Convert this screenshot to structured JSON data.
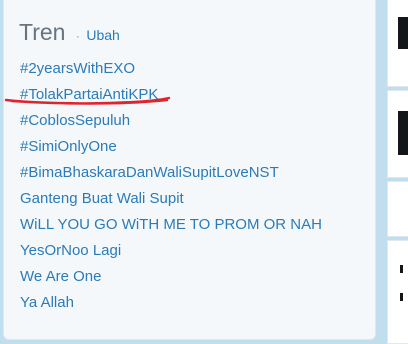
{
  "trends_module": {
    "title": "Tren",
    "separator": "·",
    "change_label": "Ubah",
    "items": [
      "#2yearsWithEXO",
      "#TolakPartaiAntiKPK",
      "#CoblosSepuluh",
      "#SimiOnlyOne",
      "#BimaBhaskaraDanWaliSupitLoveNST",
      "Ganteng Buat Wali Supit",
      "WiLL YOU GO WiTH ME TO PROM OR NAH",
      "YesOrNoo Lagi",
      "We Are One",
      "Ya Allah"
    ]
  },
  "colors": {
    "link": "#2b7bb9",
    "title": "#66757f",
    "annotation": "#e0242b",
    "page_background": "#c0deed",
    "card_background": "#f5f8fa"
  },
  "annotation": {
    "type": "red-handdrawn-underline",
    "target_item": "#TolakPartaiAntiKPK"
  }
}
